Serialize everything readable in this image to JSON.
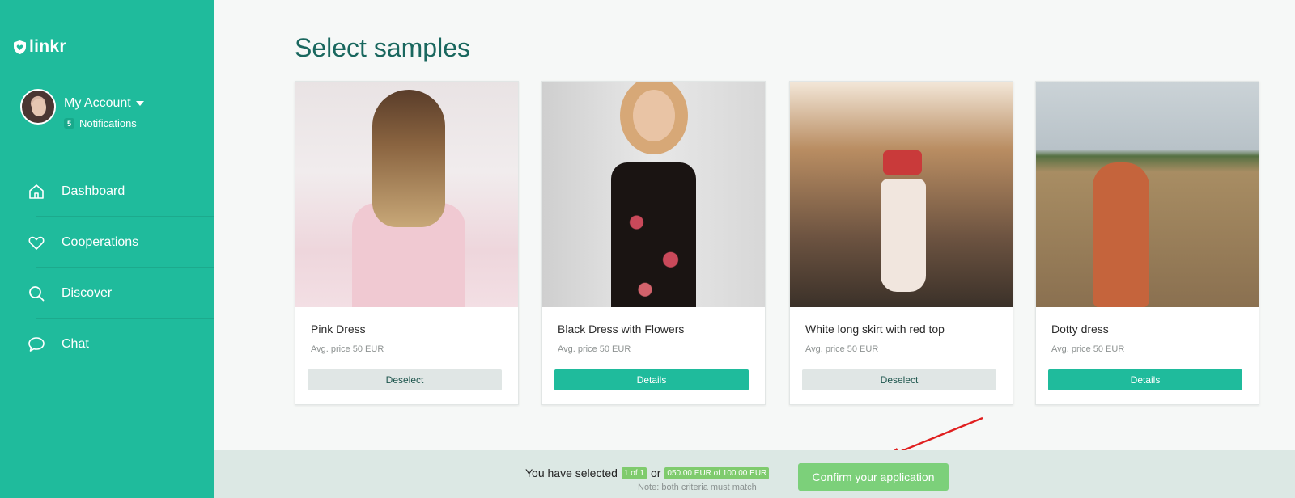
{
  "app": {
    "logo_text": "linkr",
    "brand_color": "#1fbb9c"
  },
  "account": {
    "name": "My Account",
    "notification_count": "5",
    "notifications_label": "Notifications"
  },
  "nav": [
    {
      "label": "Dashboard",
      "icon": "home-icon"
    },
    {
      "label": "Cooperations",
      "icon": "heart-icon"
    },
    {
      "label": "Discover",
      "icon": "search-icon"
    },
    {
      "label": "Chat",
      "icon": "chat-bubble-icon"
    }
  ],
  "page": {
    "title": "Select samples"
  },
  "samples": [
    {
      "name": "Pink Dress",
      "price": "Avg. price 50 EUR",
      "button": "Deselect",
      "selected": true
    },
    {
      "name": "Black Dress with Flowers",
      "price": "Avg. price 50 EUR",
      "button": "Details",
      "selected": false
    },
    {
      "name": "White long skirt with red top",
      "price": "Avg. price 50 EUR",
      "button": "Deselect",
      "selected": true
    },
    {
      "name": "Dotty dress",
      "price": "Avg. price 50 EUR",
      "button": "Details",
      "selected": false
    }
  ],
  "footer": {
    "selected_prefix": "You have selected",
    "count_pill": "1 of 1",
    "or_text": "or",
    "amount_pill": "050.00 EUR of 100.00 EUR",
    "note": "Note: both criteria must match",
    "confirm_label": "Confirm your application",
    "pill_color": "#7fcb6d",
    "annotation_color": "#e02020"
  }
}
